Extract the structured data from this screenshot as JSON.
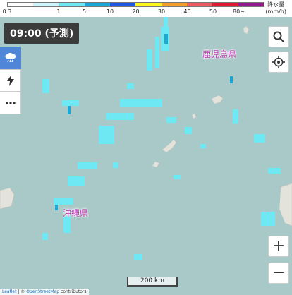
{
  "legend": {
    "colors": [
      "#ffffff",
      "#cdf7fc",
      "#6ee8f2",
      "#1aa9d6",
      "#2057e5",
      "#fbf51c",
      "#f5a02c",
      "#ef5b62",
      "#e01b33",
      "#921a8c"
    ],
    "ticks": [
      "0.3",
      "1",
      "5",
      "10",
      "20",
      "30",
      "40",
      "50",
      "80~"
    ],
    "unit_label": "降水量",
    "unit": "(mm/h)"
  },
  "time_badge": "09:00 (予測)",
  "toolbar": {
    "rain_icon": "rain-cloud-icon",
    "lightning_icon": "lightning-icon",
    "more_icon": "more-dots-icon"
  },
  "controls": {
    "search_icon": "search-icon",
    "locate_icon": "locate-icon",
    "zoom_in": "+",
    "zoom_out": "−"
  },
  "map": {
    "labels": {
      "kagoshima": "鹿児島県",
      "okinawa": "沖縄県"
    },
    "scale": "200 km"
  },
  "attribution": {
    "leaflet": "Leaflet",
    "sep": " | © ",
    "osm": "OpenStreetMap",
    "contributors": " contributors"
  }
}
